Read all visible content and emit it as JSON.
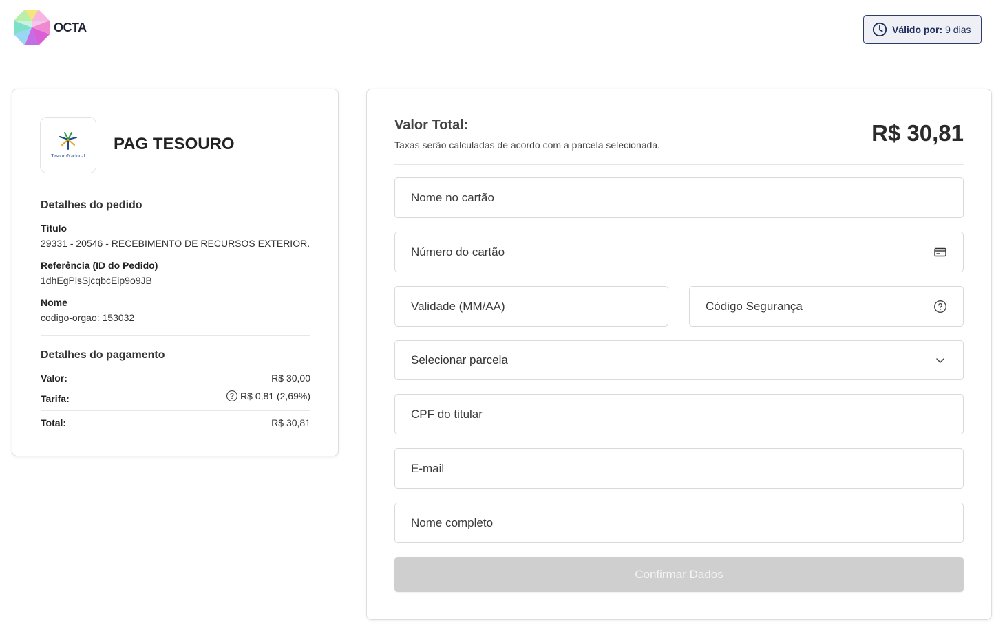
{
  "brand": {
    "name": "OCTA",
    "logo_icon": "octa-gem-logo"
  },
  "validity": {
    "label": "Válido por:",
    "value": "9 dias",
    "icon": "clock-icon"
  },
  "merchant": {
    "name": "PAG TESOURO",
    "logo_text": "TesouroNacional"
  },
  "order": {
    "title": "Detalhes do pedido",
    "items": [
      {
        "label": "Título",
        "value": "29331 - 20546 - RECEBIMENTO DE RECURSOS EXTERIOR."
      },
      {
        "label": "Referência (ID do Pedido)",
        "value": "1dhEgPlsSjcqbcEip9o9JB"
      },
      {
        "label": "Nome",
        "value": "codigo-orgao: 153032"
      }
    ]
  },
  "payment": {
    "title": "Detalhes do pagamento",
    "valor_label": "Valor:",
    "valor": "R$ 30,00",
    "tarifa_label": "Tarifa:",
    "tarifa": "R$ 0,81 (2,69%)",
    "total_label": "Total:",
    "total": "R$ 30,81"
  },
  "summary": {
    "title": "Valor Total:",
    "subtitle": "Taxas serão calculadas de acordo com a parcela selecionada.",
    "amount": "R$ 30,81"
  },
  "form": {
    "card_name": "Nome no cartão",
    "card_number": "Número do cartão",
    "expiry": "Validade (MM/AA)",
    "cvv": "Código Segurança",
    "installments": "Selecionar parcela",
    "cpf": "CPF do titular",
    "email": "E-mail",
    "full_name": "Nome completo",
    "submit": "Confirmar Dados"
  },
  "colors": {
    "accent": "#2d3c6b",
    "button_disabled": "#cfcfcf"
  }
}
